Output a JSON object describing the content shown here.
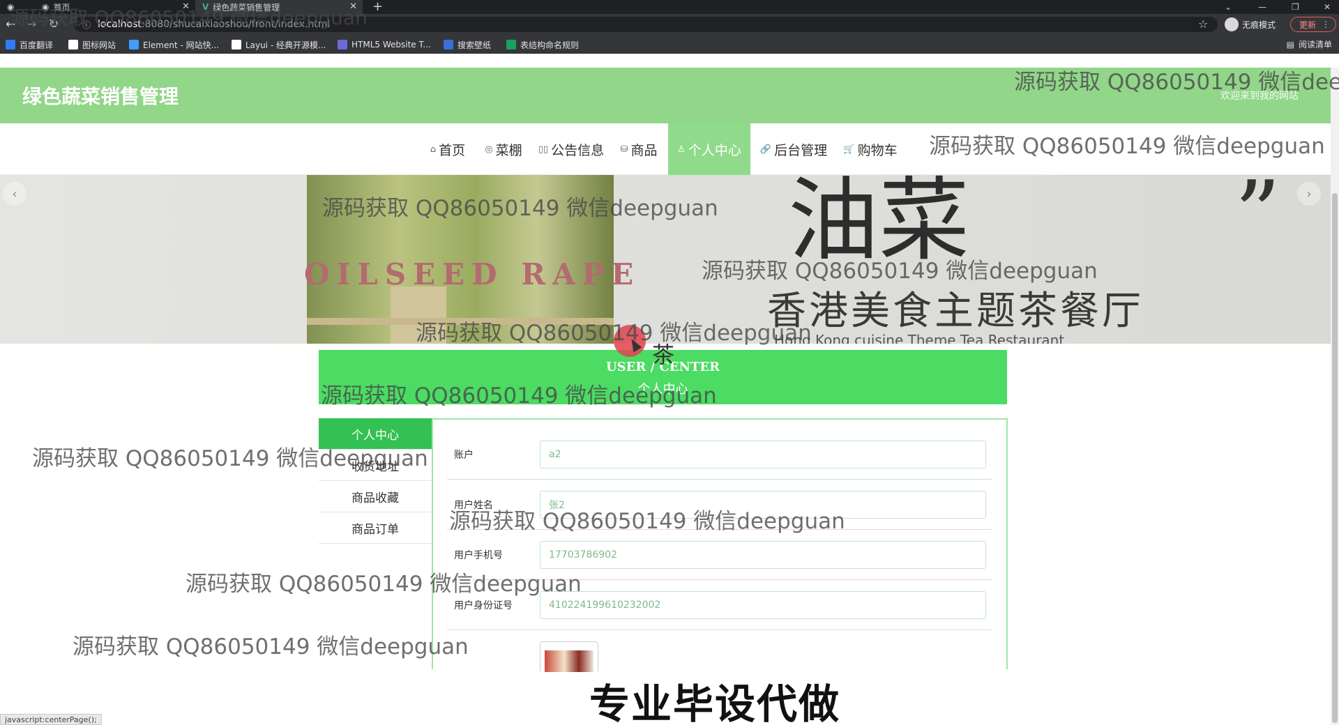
{
  "browser": {
    "tabs": [
      {
        "title": "首页"
      },
      {
        "title": "绿色蔬菜销售管理"
      }
    ],
    "url_host": "localhost",
    "url_path": ":8080/shucaixiaoshou/front/index.html",
    "incognito_label": "无痕模式",
    "update_label": "更新",
    "reading_list": "阅读清单",
    "bookmarks": [
      {
        "label": "百度翻译",
        "color": "#2f7cf6"
      },
      {
        "label": "图标网站",
        "color": "#ffffff"
      },
      {
        "label": "Element - 网站快...",
        "color": "#409eff"
      },
      {
        "label": "Layui - 经典开源模...",
        "color": "#ffffff"
      },
      {
        "label": "HTML5 Website T...",
        "color": "#6b6bd6"
      },
      {
        "label": "搜索壁纸",
        "color": "#3b6fd8"
      },
      {
        "label": "表结构命名规则",
        "color": "#19a15f"
      }
    ]
  },
  "site": {
    "title": "绿色蔬菜销售管理",
    "welcome": "欢迎来到我的网站",
    "nav": [
      {
        "icon": "⌂",
        "label": "首页"
      },
      {
        "icon": "◎",
        "label": "菜棚"
      },
      {
        "icon": "▯▯",
        "label": "公告信息"
      },
      {
        "icon": "⛁",
        "label": "商品"
      },
      {
        "icon": "♙",
        "label": "个人中心"
      },
      {
        "icon": "🔗",
        "label": "后台管理"
      },
      {
        "icon": "🛒",
        "label": "购物车"
      }
    ],
    "active_nav": "个人中心"
  },
  "banner": {
    "left_text": "OILSEED RAPE",
    "big_text": "油菜",
    "sub_text": "香港美食主题茶餐厅",
    "sub_en": "Hong Kong cuisine Theme Tea Restaurant"
  },
  "user_center": {
    "title_en": "USER / CENTER",
    "title_cn": "个人中心",
    "stray_char": "茶",
    "menu": [
      "个人中心",
      "收货地址",
      "商品收藏",
      "商品订单"
    ],
    "active_menu": "个人中心",
    "fields": [
      {
        "label": "账户",
        "value": "a2"
      },
      {
        "label": "用户姓名",
        "value": "张2"
      },
      {
        "label": "用户手机号",
        "value": "17703786902"
      },
      {
        "label": "用户身份证号",
        "value": "410224199610232002"
      }
    ]
  },
  "caption": "专业毕设代做",
  "status_text": "javascript:centerPage();",
  "watermark": "源码获取 QQ86050149 微信deepguan",
  "colors": {
    "header_green": "#92d68a",
    "nav_active": "#90db8b",
    "uc_banner": "#4cdb63",
    "side_active": "#34c153"
  }
}
